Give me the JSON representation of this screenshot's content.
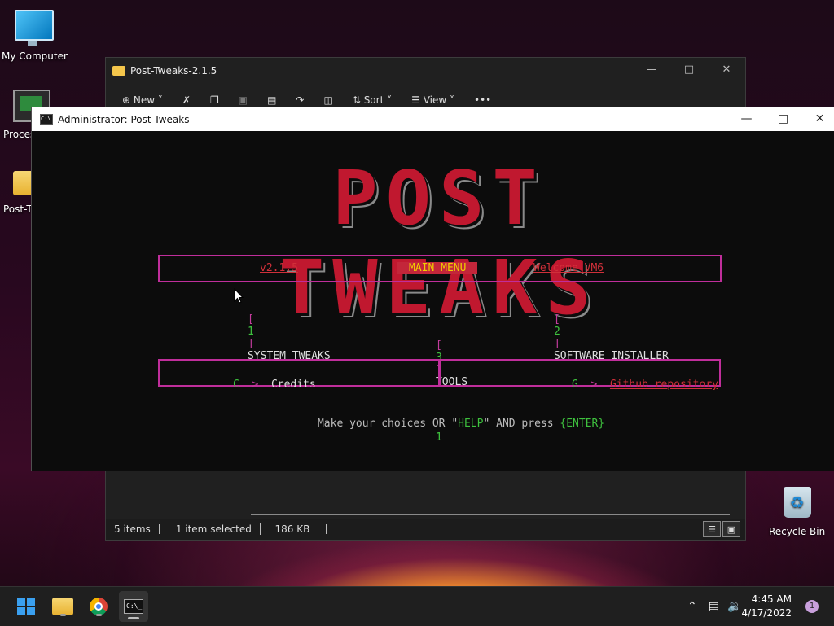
{
  "desktop": {
    "icons": [
      {
        "label": "My Computer"
      },
      {
        "label": "Proces"
      },
      {
        "label": "Post-T"
      },
      {
        "label": "Recycle Bin"
      }
    ]
  },
  "explorer": {
    "title": "Post-Tweaks-2.1.5",
    "toolbar": {
      "new_label": "New",
      "sort_label": "Sort",
      "view_label": "View",
      "more_label": "•••"
    },
    "status": {
      "items": "5 items",
      "selected": "1 item selected",
      "size": "186 KB"
    }
  },
  "console": {
    "title": "Administrator:  Post Tweaks",
    "logo": "POST TWEAKS",
    "header": {
      "version": "v2.1.5",
      "banner": "MAIN MENU",
      "welcome": "Welcome VM6"
    },
    "menu": [
      {
        "open": "[",
        "key": "1",
        "close": "]",
        "label": "SYSTEM TWEAKS"
      },
      {
        "open": "[",
        "key": "2",
        "close": "]",
        "label": "SOFTWARE INSTALLER"
      },
      {
        "open": "[",
        "key": "3",
        "close": "]",
        "label": "TOOLS"
      }
    ],
    "footer": {
      "credits_key": "C",
      "credits_arrow": ">",
      "credits_label": "Credits",
      "github_key": "G",
      "github_arrow": ">",
      "github_label": "Github repository"
    },
    "prompt": {
      "text1": "Make your choices OR \"",
      "help": "HELP",
      "text2": "\" AND press ",
      "enter": "{ENTER}"
    },
    "input_value": "1"
  },
  "taskbar": {
    "time": "4:45 AM",
    "date": "4/17/2022",
    "notifications": "1"
  }
}
